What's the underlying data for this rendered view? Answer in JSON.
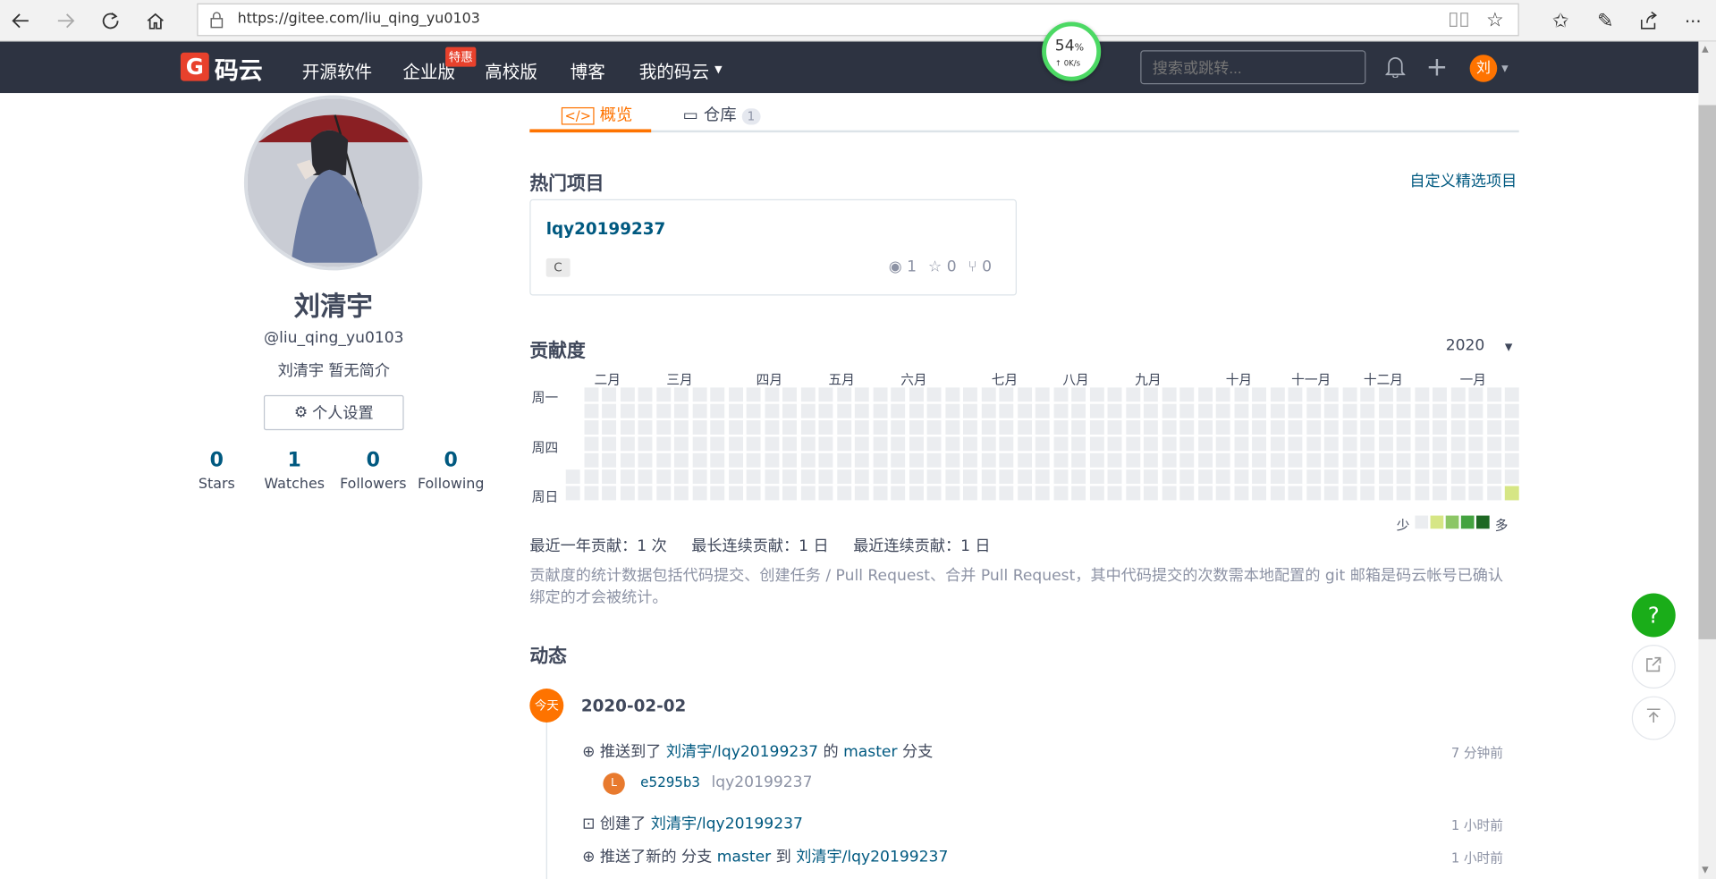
{
  "browser": {
    "url": "https://gitee.com/liu_qing_yu0103"
  },
  "brand": {
    "logo_text": "码云",
    "accent": "#fe7300",
    "nav_bg": "#2d3341"
  },
  "nav": {
    "items": [
      "开源软件",
      "企业版",
      "高校版",
      "博客",
      "我的码云"
    ],
    "enterprise_badge": "特惠",
    "search_placeholder": "搜索或跳转...",
    "avatar_letter": "刘"
  },
  "speed_widget": {
    "percent": "54",
    "unit": "%",
    "rate": "↑ 0K/s"
  },
  "profile": {
    "name": "刘清宇",
    "handle": "@liu_qing_yu0103",
    "bio": "刘清宇 暂无简介",
    "settings_label": "个人设置",
    "stats": [
      {
        "value": "0",
        "label": "Stars"
      },
      {
        "value": "1",
        "label": "Watches"
      },
      {
        "value": "0",
        "label": "Followers"
      },
      {
        "value": "0",
        "label": "Following"
      }
    ]
  },
  "tabs": {
    "overview": "概览",
    "repos": "仓库",
    "repos_count": "1"
  },
  "hot": {
    "title": "热门项目",
    "customize": "自定义精选项目",
    "project": {
      "name": "lqy20199237",
      "lang": "C",
      "watches": "1",
      "stars": "0",
      "forks": "0"
    }
  },
  "contrib": {
    "title": "贡献度",
    "year": "2020",
    "months": [
      "二月",
      "三月",
      "四月",
      "五月",
      "六月",
      "七月",
      "八月",
      "九月",
      "十月",
      "十一月",
      "十二月",
      "一月"
    ],
    "days": [
      "周一",
      "周四",
      "周日"
    ],
    "legend_less": "少",
    "legend_more": "多",
    "summary": [
      "最近一年贡献：1 次",
      "最长连续贡献：1 日",
      "最近连续贡献：1 日"
    ],
    "note_line1": "贡献度的统计数据包括代码提交、创建任务 / Pull Request、合并 Pull Request，其中代码提交的次数需本地配置的 git 邮箱是码云帐号已确认",
    "note_line2": "绑定的才会被统计。"
  },
  "activity": {
    "title": "动态",
    "today_badge": "今天",
    "date": "2020-02-02",
    "events": [
      {
        "pre": "推送到了",
        "repo": "刘清宇/lqy20199237",
        "mid": "的",
        "branch": "master",
        "post": "分支",
        "time": "7 分钟前"
      },
      {
        "pre": "创建了",
        "repo": "刘清宇/lqy20199237",
        "time": "1 小时前"
      },
      {
        "pre": "推送了新的 分支",
        "branch": "master",
        "mid": "到",
        "repo": "刘清宇/lqy20199237",
        "time": "1 小时前"
      }
    ],
    "commit": {
      "avatar_letter": "L",
      "sha": "e5295b3",
      "message": "lqy20199237"
    }
  },
  "floating": {
    "help": "?"
  }
}
